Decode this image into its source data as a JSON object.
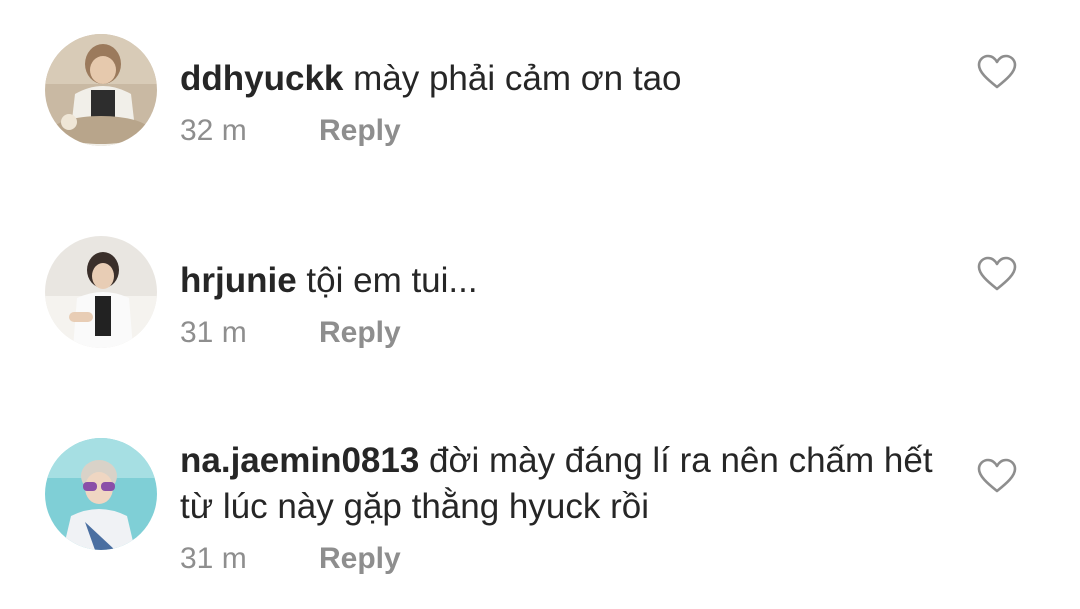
{
  "comments": [
    {
      "username": "ddhyuckk",
      "text": "mày phải cảm ơn tao",
      "time": "32 m",
      "reply_label": "Reply"
    },
    {
      "username": "hrjunie",
      "text": "tội em tui...",
      "time": "31 m",
      "reply_label": "Reply"
    },
    {
      "username": "na.jaemin0813",
      "text": "đời mày đáng lí ra nên chấm hết từ lúc này gặp thằng hyuck rồi",
      "time": "31 m",
      "reply_label": "Reply"
    }
  ],
  "icons": {
    "like": "heart-outline-icon"
  },
  "colors": {
    "text": "#262626",
    "meta": "#8e8e8e",
    "heart_stroke": "#8e8e8e",
    "background": "#ffffff"
  }
}
